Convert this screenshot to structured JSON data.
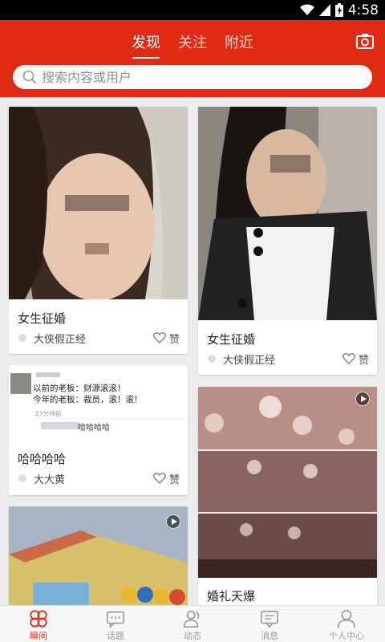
{
  "status_bar": {
    "time": "4:58"
  },
  "header": {
    "tabs": [
      {
        "label": "发现",
        "active": true
      },
      {
        "label": "关注",
        "active": false
      },
      {
        "label": "附近",
        "active": false
      }
    ]
  },
  "search": {
    "placeholder": "搜索内容或用户"
  },
  "feed": {
    "cards": [
      {
        "title": "女生征婚",
        "author": "大侠假正经",
        "like_label": "赞"
      },
      {
        "title": "女生征婚",
        "author": "大侠假正经",
        "like_label": "赞"
      },
      {
        "title": "哈哈哈哈",
        "author": "大大黄",
        "like_label": "赞",
        "post_lines": [
          "以前的老板：财源滚滚！",
          "今年的老板：裁员，滚！滚！"
        ],
        "post_time": "33分钟前",
        "post_comment": "哈哈哈哈"
      },
      {
        "title": "婚礼天爆"
      }
    ]
  },
  "bottom_nav": [
    {
      "label": "瞬间",
      "icon": "moments-icon",
      "active": true
    },
    {
      "label": "话题",
      "icon": "topics-icon",
      "active": false
    },
    {
      "label": "动态",
      "icon": "activity-icon",
      "active": false
    },
    {
      "label": "消息",
      "icon": "messages-icon",
      "active": false
    },
    {
      "label": "个人中心",
      "icon": "profile-icon",
      "active": false
    }
  ],
  "colors": {
    "brand": "#e02a14",
    "background": "#ececec"
  }
}
